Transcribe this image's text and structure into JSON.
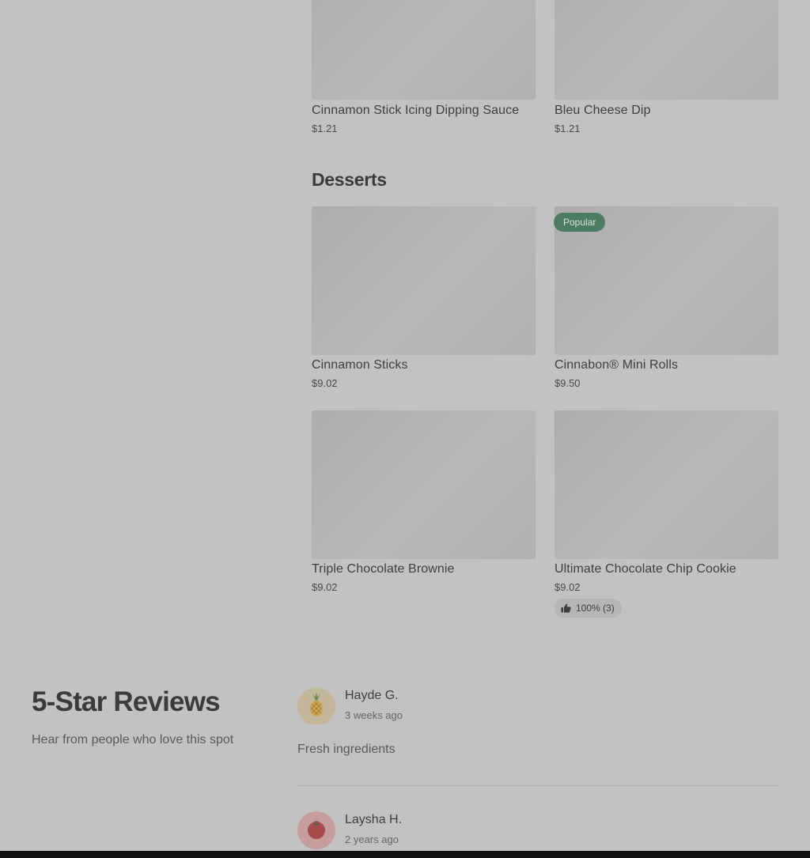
{
  "sauces": {
    "items": [
      {
        "name": "Cinnamon Stick Icing Dipping Sauce",
        "price": "$1.21"
      },
      {
        "name": "Bleu Cheese Dip",
        "price": "$1.21"
      }
    ]
  },
  "desserts": {
    "title": "Desserts",
    "items": [
      {
        "name": "Cinnamon Sticks",
        "price": "$9.02"
      },
      {
        "name": "Cinnabon® Mini Rolls",
        "price": "$9.50",
        "badge": "Popular"
      },
      {
        "name": "Triple Chocolate Brownie",
        "price": "$9.02"
      },
      {
        "name": "Ultimate Chocolate Chip Cookie",
        "price": "$9.02",
        "rating": "100% (3)"
      }
    ]
  },
  "reviews": {
    "heading": "5-Star Reviews",
    "subheading": "Hear from people who love this spot",
    "items": [
      {
        "name": "Hayde G.",
        "time": "3 weeks ago",
        "text": "Fresh ingredients",
        "avatar_icon": "pineapple-icon"
      },
      {
        "name": "Laysha H.",
        "time": "2 years ago",
        "avatar_icon": "tomato-icon"
      }
    ]
  },
  "colors": {
    "overlay_background": "#c2c2c2",
    "badge_green": "#4c7c61"
  }
}
